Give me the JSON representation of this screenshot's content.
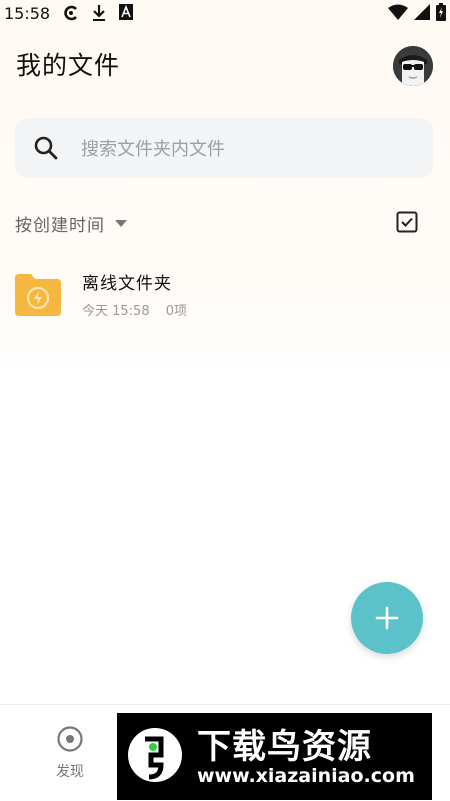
{
  "status_bar": {
    "time": "15:58"
  },
  "header": {
    "title": "我的文件"
  },
  "search": {
    "placeholder": "搜索文件夹内文件"
  },
  "sort": {
    "label": "按创建时间"
  },
  "files": [
    {
      "name": "离线文件夹",
      "date": "今天 15:58",
      "count": "0项",
      "icon": "offline-folder-icon"
    }
  ],
  "bottom_nav": {
    "discover_label": "发现"
  },
  "watermark": {
    "title": "下载鸟资源",
    "url": "www.xiazainiao.com"
  },
  "colors": {
    "fab": "#5bc2c9",
    "folder": "#f6b740"
  }
}
